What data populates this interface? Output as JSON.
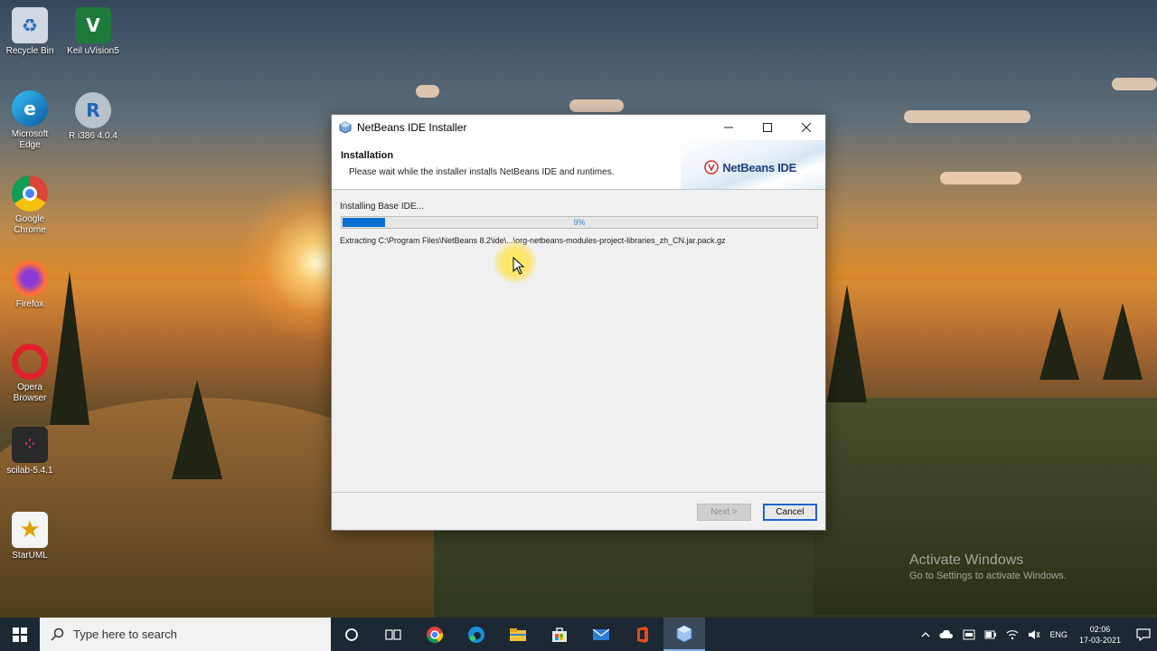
{
  "desktop": {
    "icons": [
      {
        "label": "Recycle Bin",
        "icon": "recycle-bin-icon"
      },
      {
        "label": "Keil uVision5",
        "icon": "keil-icon"
      },
      {
        "label": "Microsoft Edge",
        "icon": "edge-icon"
      },
      {
        "label": "R i386 4.0.4",
        "icon": "r-icon"
      },
      {
        "label": "Google Chrome",
        "icon": "chrome-icon"
      },
      {
        "label": "Firefox",
        "icon": "firefox-icon"
      },
      {
        "label": "Opera Browser",
        "icon": "opera-icon"
      },
      {
        "label": "scilab-5.4.1",
        "icon": "scilab-icon"
      },
      {
        "label": "StarUML",
        "icon": "staruml-icon"
      }
    ],
    "watermark": {
      "line1": "Activate Windows",
      "line2": "Go to Settings to activate Windows."
    }
  },
  "window": {
    "title": "NetBeans IDE Installer",
    "header_title": "Installation",
    "header_subtitle": "Please wait while the installer installs NetBeans IDE and runtimes.",
    "logo_text": "NetBeans IDE",
    "status_text": "Installing Base IDE...",
    "progress": {
      "percent": 9,
      "label": "9%",
      "color": "#0b6fd1"
    },
    "detail_text": "Extracting C:\\Program Files\\NetBeans 8.2\\ide\\...\\org-netbeans-modules-project-libraries_zh_CN.jar.pack.gz",
    "next_label": "Next >",
    "cancel_label": "Cancel"
  },
  "taskbar": {
    "search_placeholder": "Type here to search",
    "apps": [
      "cortana-icon",
      "task-view-icon",
      "chrome-icon",
      "edge-icon",
      "file-explorer-icon",
      "store-icon",
      "mail-icon",
      "office-icon",
      "netbeans-installer-icon"
    ],
    "language": "ENG",
    "time": "02:06",
    "date": "17-03-2021"
  }
}
